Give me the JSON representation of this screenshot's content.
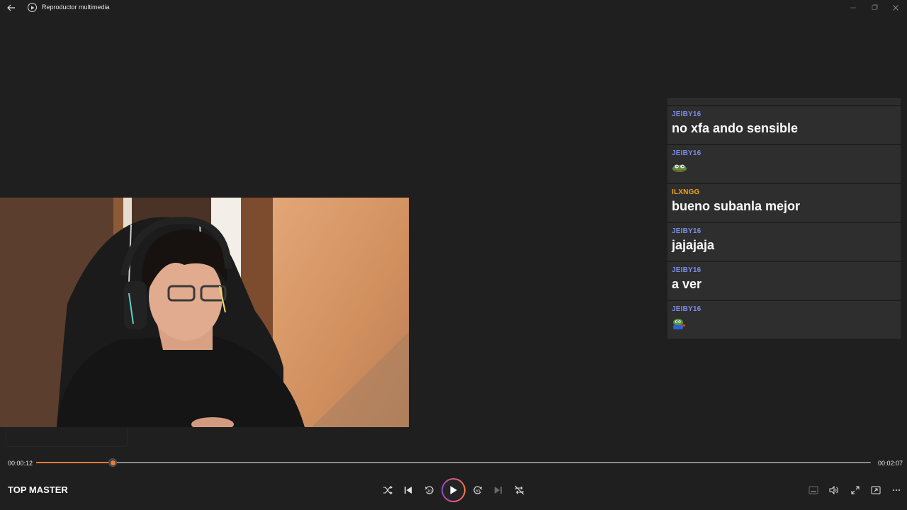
{
  "window": {
    "title": "Reproductor multimedia",
    "icons": {
      "back": "back-arrow-icon",
      "app": "play-circle-icon",
      "minimize": "minimize-icon",
      "maximize": "maximize-icon",
      "close": "close-icon"
    }
  },
  "video": {
    "description_icon": "video-frame"
  },
  "chat": {
    "messages": [
      {
        "user": "JEIBY16",
        "text": "no xfa ando sensible",
        "user_color": "#7b8ce8"
      },
      {
        "user": "JEIBY16",
        "text": "",
        "emote": "frog-emote-icon",
        "user_color": "#7b8ce8"
      },
      {
        "user": "ILXNGG",
        "text": "bueno subanla mejor",
        "user_color": "#f0a318"
      },
      {
        "user": "JEIBY16",
        "text": "jajajaja",
        "user_color": "#7b8ce8"
      },
      {
        "user": "JEIBY16",
        "text": "a ver",
        "user_color": "#7b8ce8"
      },
      {
        "user": "JEIBY16",
        "text": "",
        "emote": "pepe-emote-icon",
        "user_color": "#7b8ce8"
      }
    ]
  },
  "playback": {
    "current_time": "00:00:12",
    "total_time": "00:02:07",
    "progress": 0.092,
    "accent": "#f07c3a"
  },
  "now_playing": {
    "title": "TOP MASTER"
  },
  "controls": {
    "shuffle": "shuffle-icon",
    "previous": "previous-icon",
    "rewind_10": "rewind-10-icon",
    "play": "play-icon",
    "forward_30": "forward-30-icon",
    "next": "next-icon",
    "repeat_off": "repeat-off-icon",
    "miniplayer": "miniplayer-icon",
    "volume": "volume-icon",
    "fullscreen": "fullscreen-icon",
    "cast": "cast-icon",
    "more": "more-icon"
  }
}
